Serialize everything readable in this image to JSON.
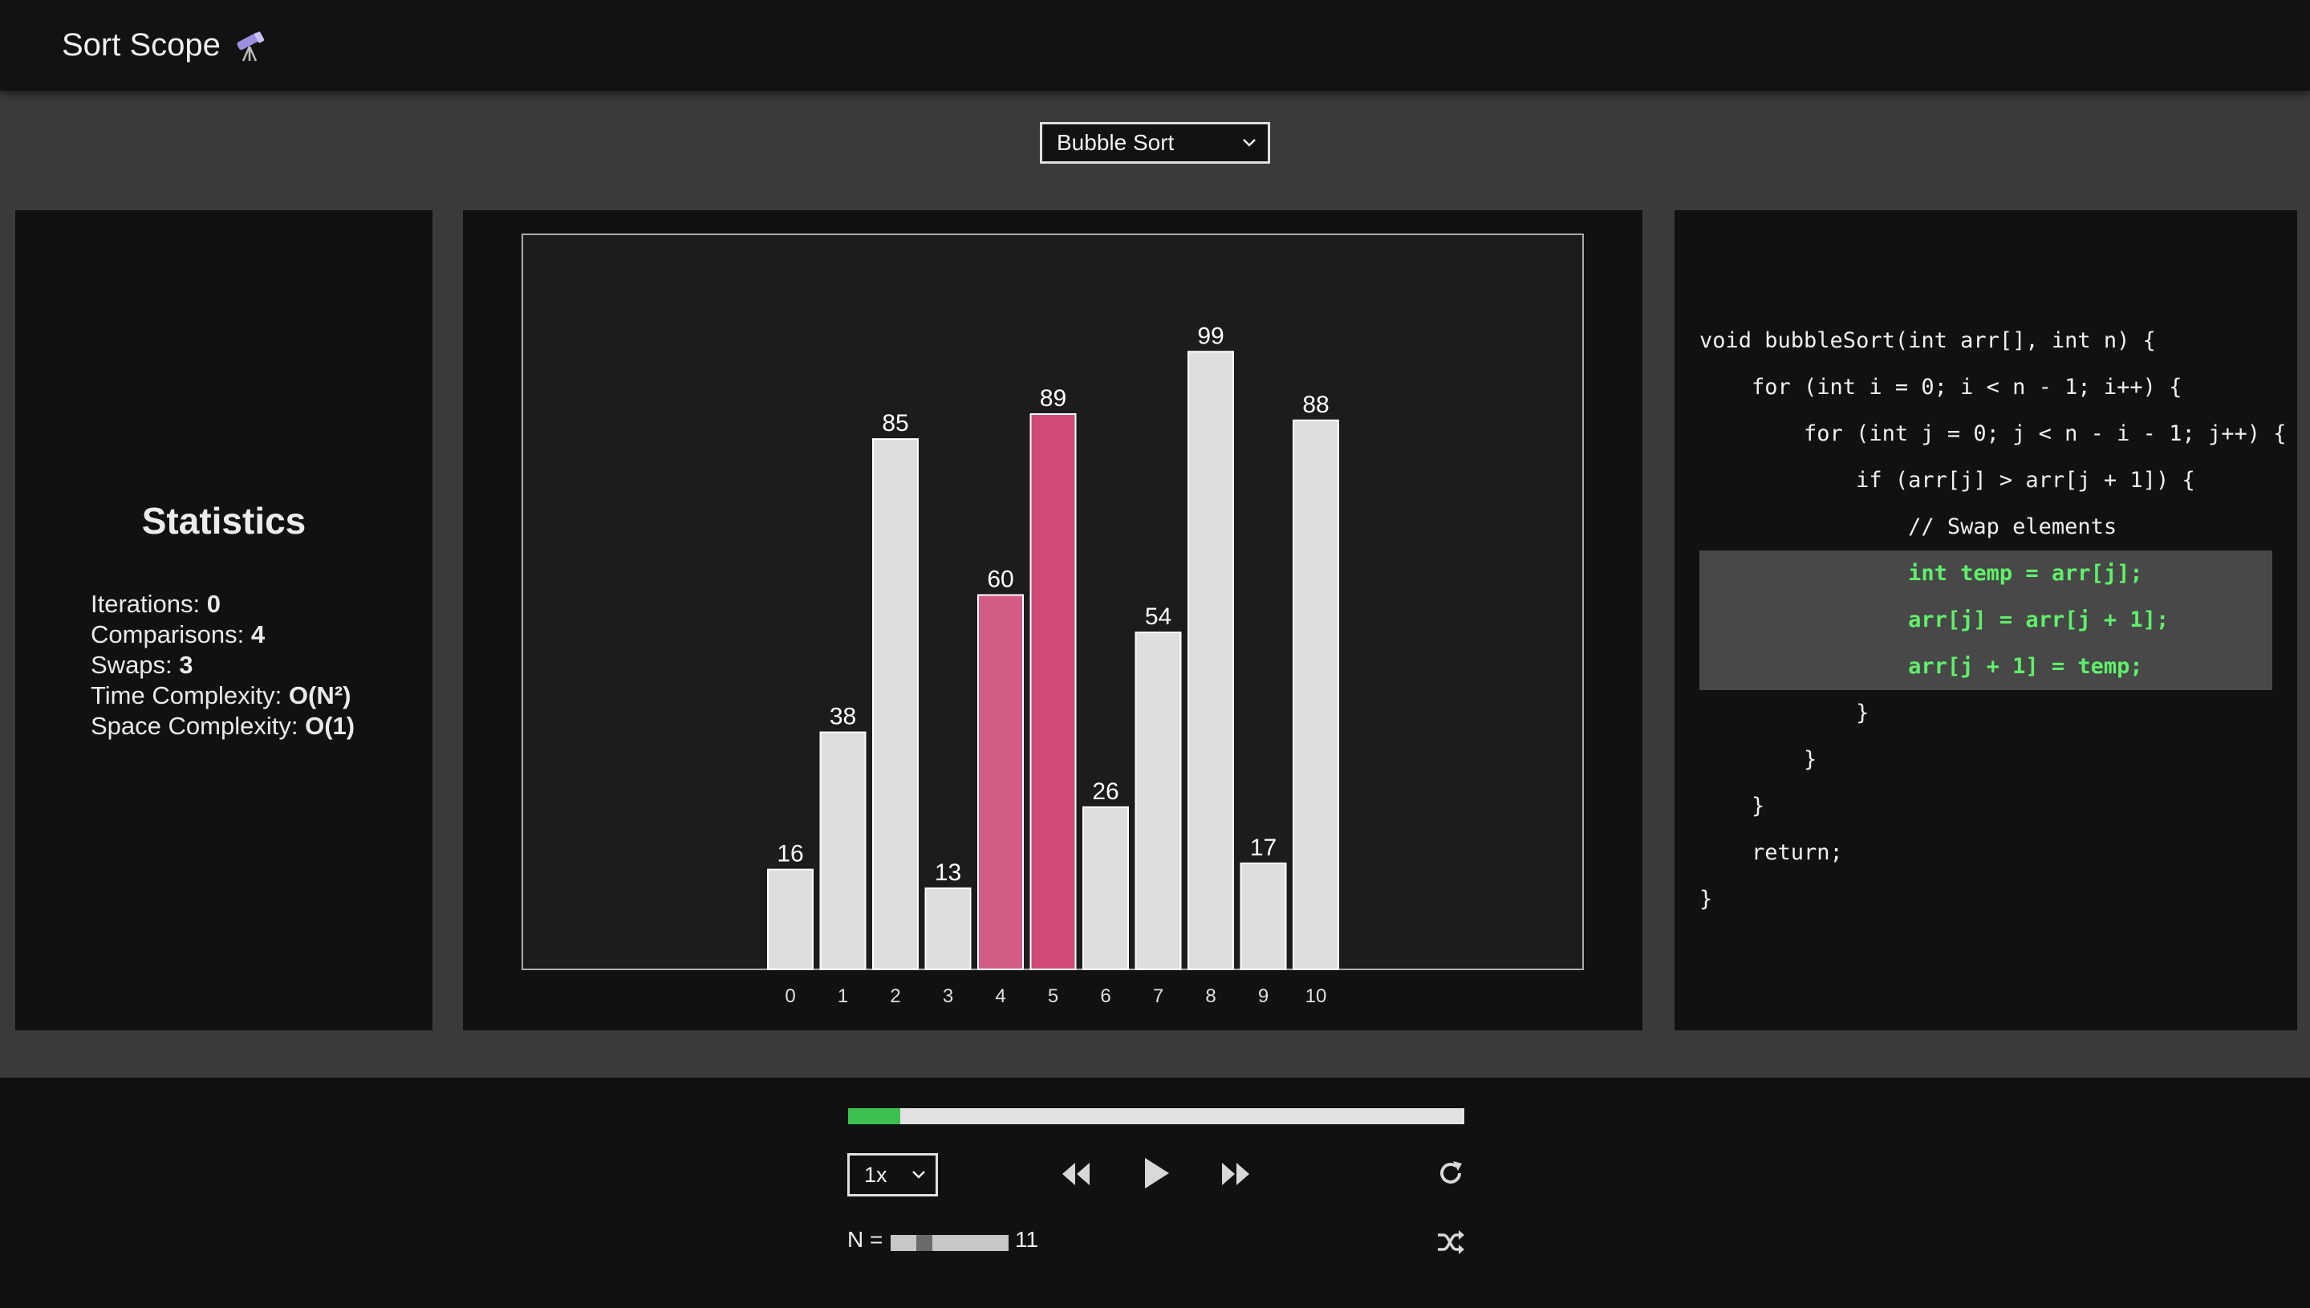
{
  "app": {
    "title": "Sort Scope"
  },
  "algorithm_select": {
    "selected": "Bubble Sort"
  },
  "stats": {
    "title": "Statistics",
    "items": [
      {
        "label": "Iterations:",
        "value": "0"
      },
      {
        "label": "Comparisons:",
        "value": "4"
      },
      {
        "label": "Swaps:",
        "value": "3"
      },
      {
        "label": "Time Complexity:",
        "value": "O(N²)"
      },
      {
        "label": "Space Complexity:",
        "value": "O(1)"
      }
    ]
  },
  "chart_data": {
    "type": "bar",
    "categories": [
      "0",
      "1",
      "2",
      "3",
      "4",
      "5",
      "6",
      "7",
      "8",
      "9",
      "10"
    ],
    "values": [
      16,
      38,
      85,
      13,
      60,
      89,
      26,
      54,
      99,
      17,
      88
    ],
    "highlighted": [
      4,
      5
    ],
    "ylim": [
      0,
      110
    ],
    "colors": {
      "bar": "#dedede",
      "highlight_a": "#d35c86",
      "highlight_b": "#d14b78",
      "label": "#ffffff"
    }
  },
  "code": {
    "lines": [
      "void bubbleSort(int arr[], int n) {",
      "    for (int i = 0; i < n - 1; i++) {",
      "        for (int j = 0; j < n - i - 1; j++) {",
      "            if (arr[j] > arr[j + 1]) {",
      "                // Swap elements",
      "                int temp = arr[j];",
      "                arr[j] = arr[j + 1];",
      "                arr[j + 1] = temp;",
      "            }",
      "        }",
      "    }",
      "    return;",
      "}"
    ],
    "highlighted_lines": [
      5,
      6,
      7
    ],
    "highlight_color": "#5ff06a"
  },
  "player": {
    "progress": 0.085,
    "speed": "1x",
    "n_label": "N =",
    "n_value": "11",
    "n_slider_fraction": 0.25
  },
  "icons": {
    "rewind": "rewind-icon",
    "play": "play-icon",
    "forward": "fast-forward-icon",
    "reset": "reset-icon",
    "shuffle": "shuffle-icon"
  }
}
